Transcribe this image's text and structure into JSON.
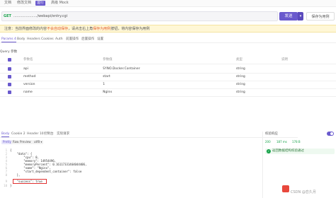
{
  "top_tabs": [
    "文档",
    "修改文档",
    "运行",
    "高级 Mock"
  ],
  "request": {
    "method": "GET",
    "url": "...................../webapi/entry.cgi",
    "send_label": "发送",
    "caret": "▾",
    "save_label": "保存为用例"
  },
  "notice": {
    "prefix": "注意：当前界面修改的内容",
    "hl1": "不会自动保存",
    "mid": "，请点击右上角",
    "hl2": "保存为用例",
    "suffix": "按钮，将内容保存为用例"
  },
  "req_tabs": [
    "Params 4",
    "Body",
    "Headers",
    "Cookies",
    "Auth",
    "前置操作",
    "后置操作",
    "设置"
  ],
  "query_label": "Query 参数",
  "params": {
    "header": {
      "name": "参数名",
      "value": "参数值",
      "type": "类型",
      "desc": "说明"
    },
    "rows": [
      {
        "name": "api",
        "value": "SYNO.Docker.Container",
        "type": "string"
      },
      {
        "name": "method",
        "value": "start",
        "type": "string"
      },
      {
        "name": "version",
        "value": "1",
        "type": "string"
      },
      {
        "name": "name",
        "value": "Nginx",
        "type": "string"
      }
    ]
  },
  "resp_tabs": [
    "Body",
    "Cookie 2",
    "Header 10",
    "控制台",
    "实际请求"
  ],
  "fmt_buttons": [
    "Pretty",
    "Raw",
    "Preview",
    "utf8 ▾"
  ],
  "code_lines": [
    "{",
    "    \"data\": {",
    "        \"cpu\": 0,",
    "        \"memory\": 14954496,",
    "        \"memoryPercent\": 0.16117331464044406,",
    "        \"name\": \"Nginx\",",
    "        \"start_dependent_container\": false",
    "    },",
    "    \"success\": true",
    "}"
  ],
  "side": {
    "title": "校验响应",
    "status": "200",
    "time": "187 ms",
    "size": "178 B",
    "assert_text": "返回数据结构校验通过"
  },
  "watermark": "CSDN @恋久月",
  "icons": {
    "assert": "✓"
  }
}
